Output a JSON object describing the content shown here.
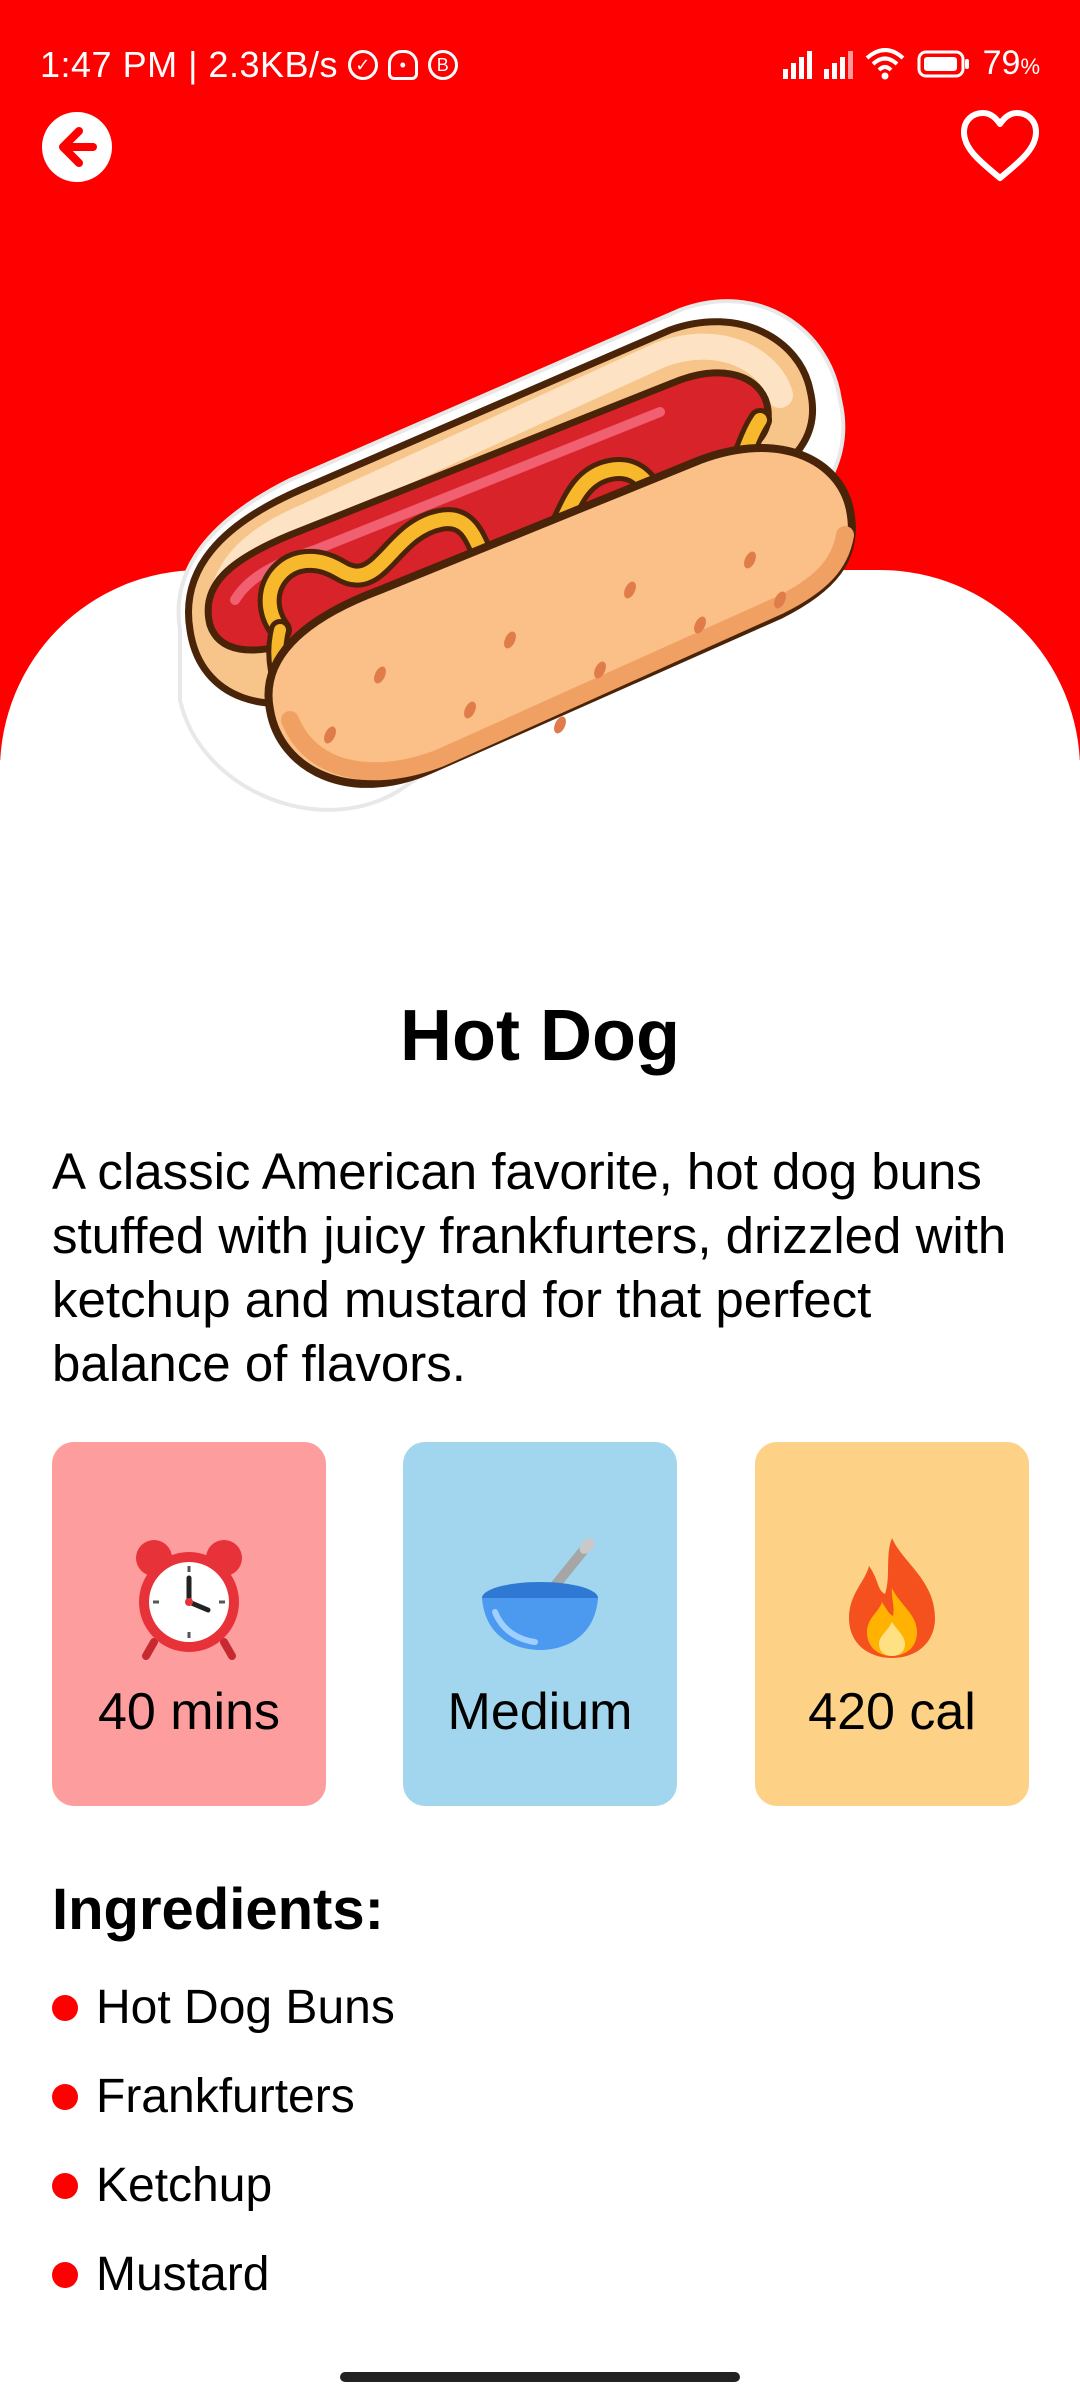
{
  "status_bar": {
    "left_text": "1:47 PM | 2.3KB/s",
    "battery": "79",
    "battery_suffix": "%"
  },
  "header": {
    "back_icon": "arrow-left-icon",
    "favorite_icon": "heart-outline-icon"
  },
  "recipe": {
    "title": "Hot Dog",
    "description": "A classic American favorite, hot dog buns stuffed with juicy frankfurters, drizzled with ketchup and mustard for that perfect balance of flavors.",
    "stats": [
      {
        "icon": "alarm-clock-icon",
        "label": "40 mins",
        "color": "#fe9d9d"
      },
      {
        "icon": "bowl-spoon-icon",
        "label": "Medium",
        "color": "#a2d6ee"
      },
      {
        "icon": "fire-icon",
        "label": "420 cal",
        "color": "#fdd286"
      }
    ],
    "ingredients_title": "Ingredients:",
    "ingredients": [
      "Hot Dog Buns",
      "Frankfurters",
      "Ketchup",
      "Mustard"
    ]
  },
  "colors": {
    "accent": "#fe0000",
    "background": "#ffffff"
  }
}
